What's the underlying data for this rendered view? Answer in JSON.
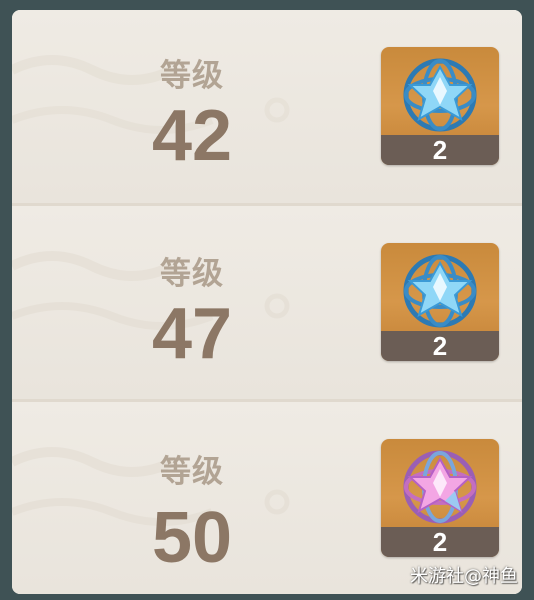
{
  "rewards": [
    {
      "label": "等级",
      "level": "42",
      "item": {
        "icon": "blue-crystal-cluster-icon",
        "count": "2",
        "tint": "#5fb6e8"
      }
    },
    {
      "label": "等级",
      "level": "47",
      "item": {
        "icon": "blue-crystal-cluster-icon",
        "count": "2",
        "tint": "#5fb6e8"
      }
    },
    {
      "label": "等级",
      "level": "50",
      "item": {
        "icon": "pink-blue-crystal-cluster-icon",
        "count": "2",
        "tint": "#e58ad2"
      }
    }
  ],
  "watermark": "米游社@神鱼",
  "colors": {
    "frame": "#3f5255",
    "panel": "#ece7df",
    "label": "#b2a494",
    "level": "#8c7765",
    "item_bg": "#d6974a",
    "count_bar": "#6b5d55"
  }
}
